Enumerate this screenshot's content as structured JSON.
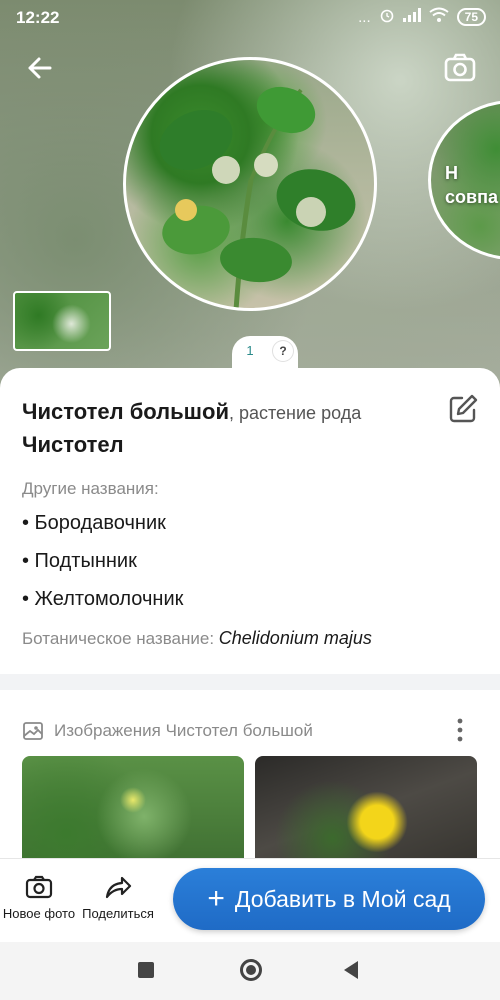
{
  "status_bar": {
    "time": "12:22",
    "dots": "...",
    "battery": "75"
  },
  "hero": {
    "side_match_text": "Н\nсовпа",
    "page_indicator": {
      "active": "1",
      "help": "?"
    }
  },
  "plant": {
    "name_bold": "Чистотел большой",
    "name_rest": ", растение рода",
    "genus": "Чистотел",
    "other_names_label": "Другие названия:",
    "other_names": [
      "• Бородавочник",
      "• Подтынник",
      "• Желтомолочник"
    ],
    "botanical_label": "Ботаническое название: ",
    "botanical_name": "Chelidonium majus"
  },
  "gallery": {
    "title": "Изображения Чистотел большой"
  },
  "actions": {
    "new_photo": "Новое фото",
    "share": "Поделиться",
    "add_to_garden": "Добавить в Мой сад"
  },
  "colors": {
    "accent": "#2b7fd9",
    "page_dot": "#2a8a8a",
    "muted_text": "#8a8a8a"
  }
}
